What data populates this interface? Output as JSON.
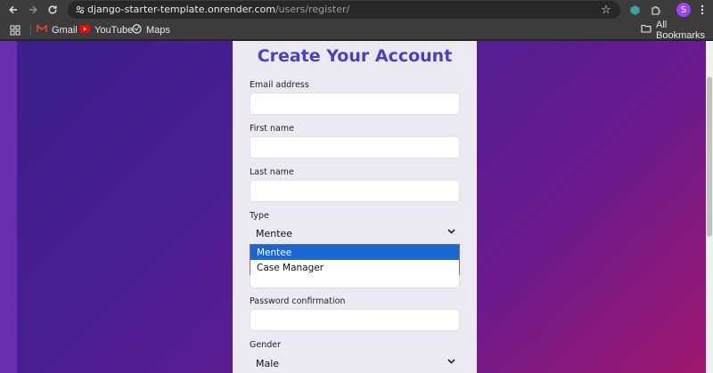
{
  "browser": {
    "url_host": "django-starter-template.onrender.com",
    "url_path": "/users/register/",
    "avatar_letter": "S",
    "icons": [
      "back-icon",
      "forward-icon",
      "reload-icon",
      "site-info-icon",
      "star-icon",
      "extension-icon",
      "puzzle-icon",
      "menu-icon"
    ]
  },
  "bookmarks": {
    "items": [
      {
        "label": "Gmail",
        "icon": "gmail-icon"
      },
      {
        "label": "YouTube",
        "icon": "youtube-icon"
      },
      {
        "label": "Maps",
        "icon": "maps-icon"
      }
    ],
    "all_bookmarks": "All Bookmarks"
  },
  "form": {
    "title": "Create Your Account",
    "email_label": "Email address",
    "first_name_label": "First name",
    "last_name_label": "Last name",
    "type_label": "Type",
    "type_value": "Mentee",
    "type_options": [
      "Mentee",
      "Case Manager"
    ],
    "password_confirmation_label": "Password confirmation",
    "gender_label": "Gender",
    "gender_value": "Male"
  },
  "colors": {
    "accent": "#4b3fc4",
    "dropdown_highlight": "#1967d2",
    "gradient_start": "#3a1f8a",
    "gradient_end": "#a0186e"
  }
}
